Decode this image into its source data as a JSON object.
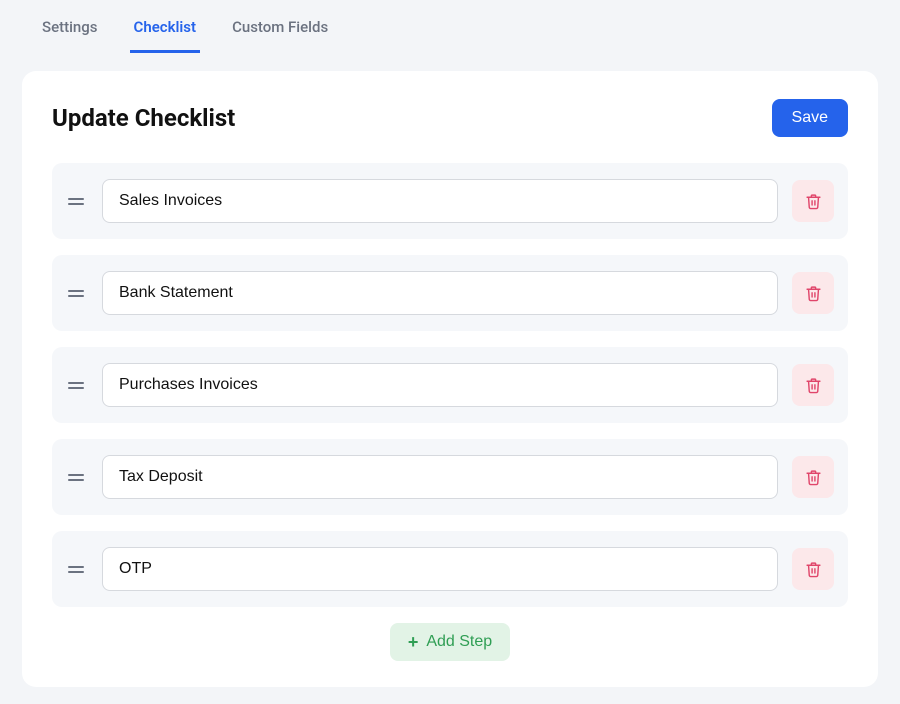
{
  "tabs": [
    {
      "label": "Settings",
      "active": false
    },
    {
      "label": "Checklist",
      "active": true
    },
    {
      "label": "Custom Fields",
      "active": false
    }
  ],
  "page": {
    "title": "Update Checklist",
    "save_label": "Save",
    "add_step_label": "Add Step"
  },
  "steps": [
    {
      "value": "Sales Invoices"
    },
    {
      "value": "Bank Statement"
    },
    {
      "value": "Purchases Invoices"
    },
    {
      "value": "Tax Deposit"
    },
    {
      "value": "OTP"
    }
  ]
}
